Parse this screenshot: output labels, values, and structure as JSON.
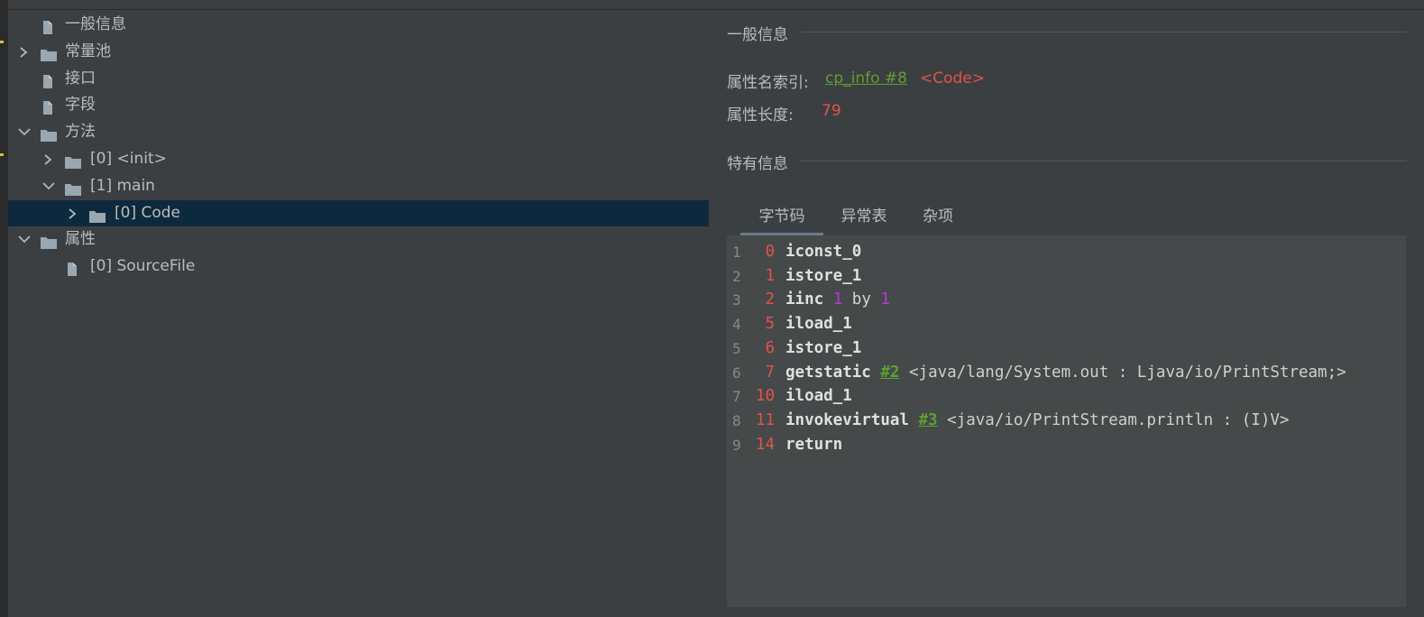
{
  "tree": {
    "items": [
      {
        "label": "一般信息",
        "icon": "file-icon"
      },
      {
        "label": "常量池",
        "icon": "folder-icon",
        "expand": "collapsed"
      },
      {
        "label": "接口",
        "icon": "file-icon"
      },
      {
        "label": "字段",
        "icon": "file-icon"
      },
      {
        "label": "方法",
        "icon": "folder-icon",
        "expand": "expanded"
      },
      {
        "label": "[0] <init>",
        "icon": "folder-icon",
        "expand": "collapsed"
      },
      {
        "label": "[1] main",
        "icon": "folder-icon",
        "expand": "expanded"
      },
      {
        "label": "[0] Code",
        "icon": "folder-icon",
        "expand": "collapsed",
        "selected": true
      },
      {
        "label": "属性",
        "icon": "folder-icon",
        "expand": "expanded"
      },
      {
        "label": "[0] SourceFile",
        "icon": "file-icon"
      }
    ]
  },
  "general": {
    "title": "一般信息",
    "name_index_label": "属性名索引:",
    "name_index_link": "cp_info #8",
    "name_index_value": "<Code>",
    "length_label": "属性长度:",
    "length_value": "79"
  },
  "specific": {
    "title": "特有信息",
    "tabs": [
      {
        "label": "字节码",
        "active": true
      },
      {
        "label": "异常表",
        "active": false
      },
      {
        "label": "杂项",
        "active": false
      }
    ]
  },
  "bytecode": [
    {
      "line": "1",
      "offset": "0",
      "op": "iconst_0"
    },
    {
      "line": "2",
      "offset": "1",
      "op": "istore_1"
    },
    {
      "line": "3",
      "offset": "2",
      "op": "iinc",
      "arg1": "1",
      "mid": "by",
      "arg2": "1"
    },
    {
      "line": "4",
      "offset": "5",
      "op": "iload_1"
    },
    {
      "line": "5",
      "offset": "6",
      "op": "istore_1"
    },
    {
      "line": "6",
      "offset": "7",
      "op": "getstatic",
      "ref": "#2",
      "comment": "<java/lang/System.out : Ljava/io/PrintStream;>"
    },
    {
      "line": "7",
      "offset": "10",
      "op": "iload_1"
    },
    {
      "line": "8",
      "offset": "11",
      "op": "invokevirtual",
      "ref": "#3",
      "comment": "<java/io/PrintStream.println : (I)V>"
    },
    {
      "line": "9",
      "offset": "14",
      "op": "return"
    }
  ],
  "colors": {
    "background": "#3c3f41",
    "selection": "#0d293e",
    "link": "#5e9f2f",
    "red": "#e2524b",
    "number": "#b23bd1"
  }
}
